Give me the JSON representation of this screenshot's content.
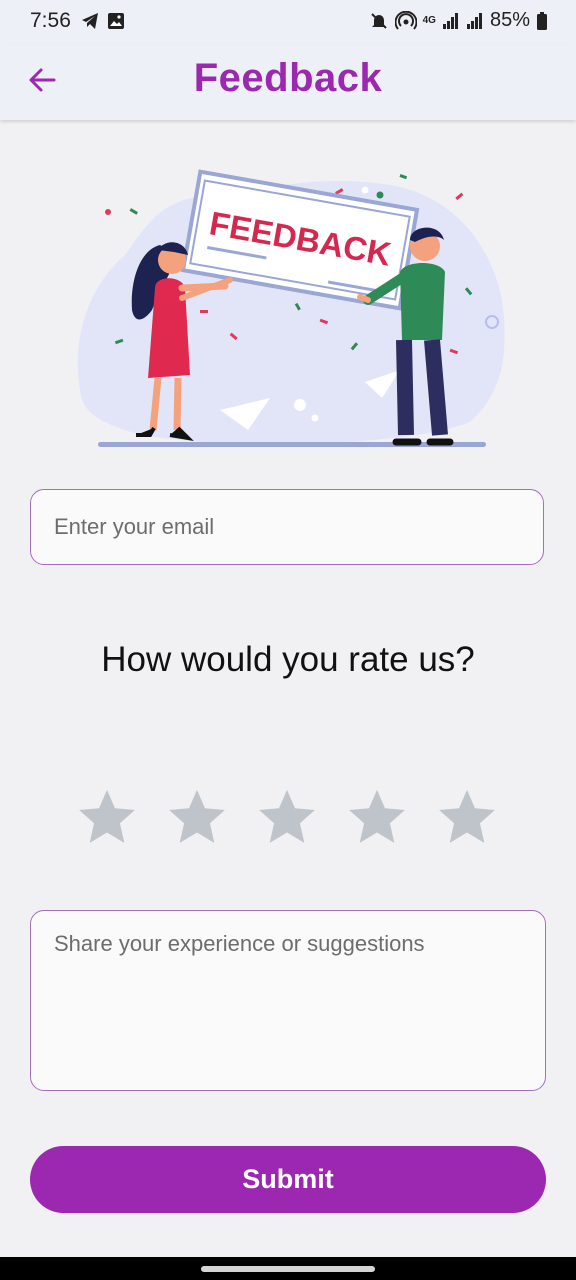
{
  "status_bar": {
    "time": "7:56",
    "battery": "85%",
    "network": "4G",
    "icons": [
      "telegram-icon",
      "gallery-icon",
      "mute-icon",
      "hotspot-icon",
      "signal-icon",
      "signal-icon",
      "battery-icon"
    ]
  },
  "header": {
    "title": "Feedback",
    "back_icon": "arrow-left-icon"
  },
  "illustration": {
    "sign_text": "FEEDBACK"
  },
  "form": {
    "email_placeholder": "Enter your email",
    "email_value": "",
    "rating_question": "How would you rate us?",
    "rating": {
      "value": 0,
      "max": 5
    },
    "message_placeholder": "Share your experience or suggestions",
    "message_value": "",
    "submit_label": "Submit"
  },
  "colors": {
    "accent": "#9c27b0",
    "star_inactive": "#bfc4ca",
    "border": "#a46fbf",
    "background": "#f1f1f3"
  }
}
